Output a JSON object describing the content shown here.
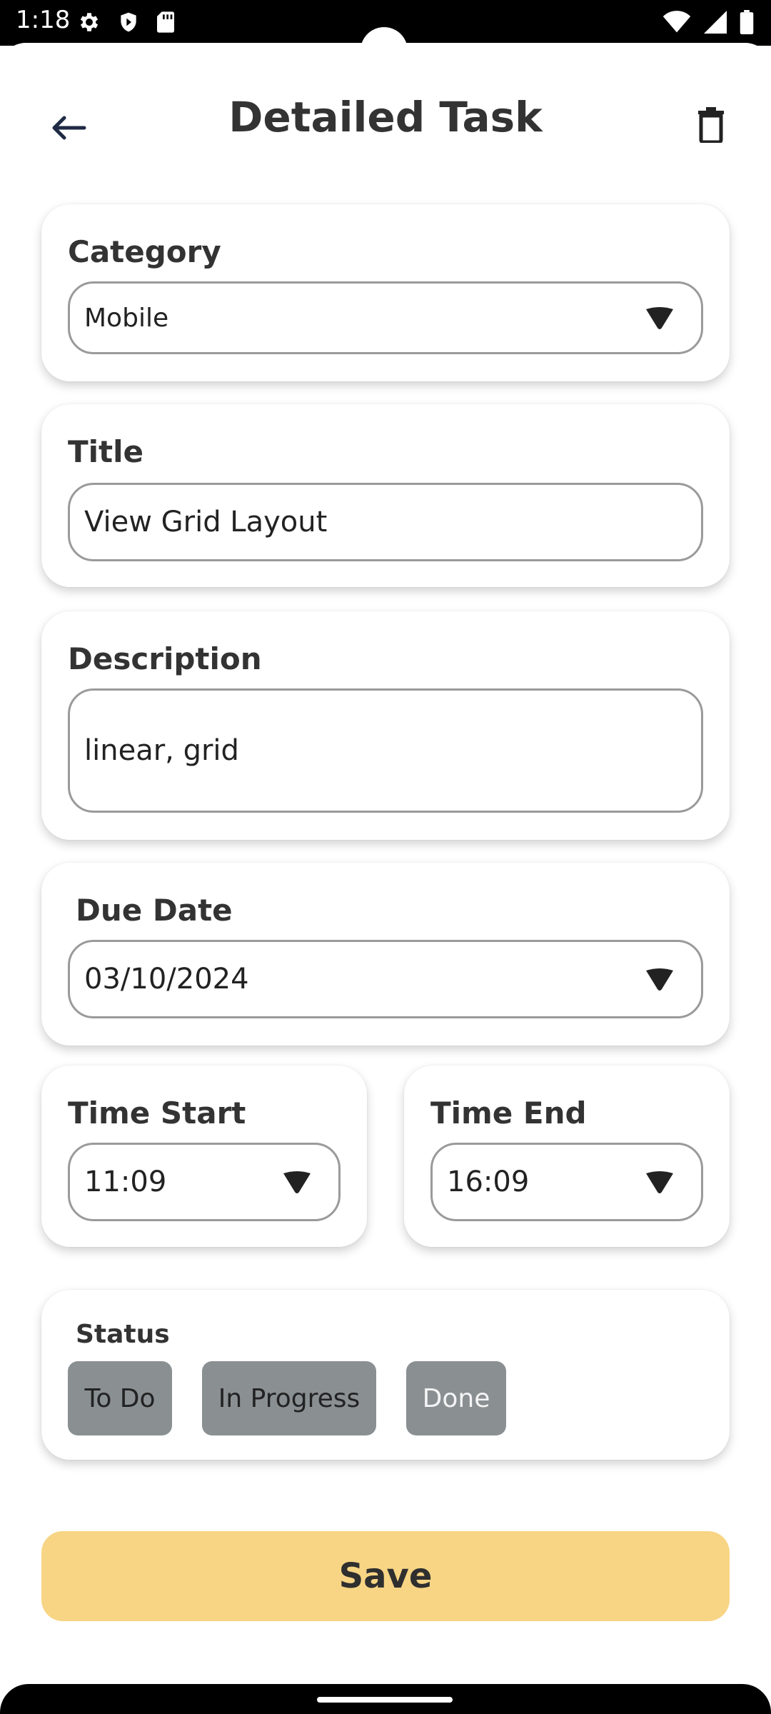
{
  "status_bar": {
    "time": "1:18",
    "icons_left": [
      "gear-icon",
      "shield-icon",
      "sd-card-icon"
    ],
    "icons_right": [
      "wifi-icon",
      "signal-icon",
      "battery-icon"
    ]
  },
  "header": {
    "title": "Detailed Task",
    "back_icon": "arrow-left-icon",
    "delete_icon": "trash-icon"
  },
  "form": {
    "category": {
      "label": "Category",
      "value": "Mobile"
    },
    "title": {
      "label": "Title",
      "value": "View Grid Layout"
    },
    "description": {
      "label": "Description",
      "value": "linear, grid"
    },
    "due_date": {
      "label": "Due Date",
      "value": "03/10/2024"
    },
    "time_start": {
      "label": "Time Start",
      "value": "11:09"
    },
    "time_end": {
      "label": "Time End",
      "value": "16:09"
    },
    "status": {
      "label": "Status",
      "options": [
        "To Do",
        "In Progress",
        "Done"
      ]
    }
  },
  "actions": {
    "save_label": "Save"
  },
  "colors": {
    "save_button": "#f7d584",
    "chip": "#8a8f92",
    "title_text": "#333333"
  }
}
